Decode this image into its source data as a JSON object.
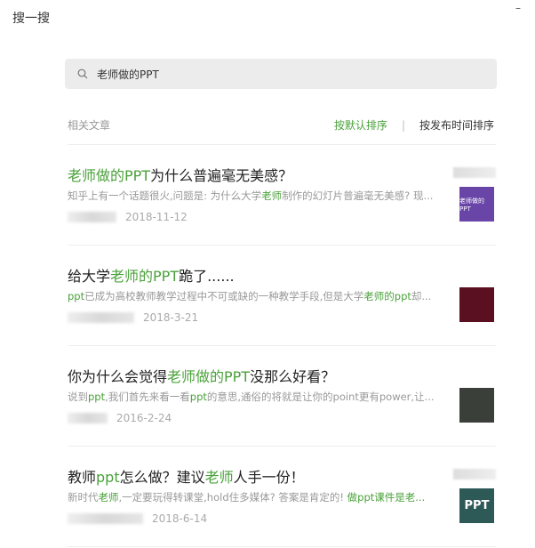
{
  "window": {
    "title": "搜一搜",
    "minimize": "–"
  },
  "search": {
    "value": "老师做的PPT"
  },
  "section_label": "相关文章",
  "sort": {
    "default": "按默认排序",
    "separator": "|",
    "by_time": "按发布时间排序"
  },
  "accent_color": "#4aa13a",
  "articles": [
    {
      "title": [
        {
          "t": "老师做的PPT",
          "hl": true
        },
        {
          "t": "为什么普遍毫无美感？",
          "hl": false
        }
      ],
      "snippet": [
        {
          "t": "知乎上有一个话题很火,问题是: 为什么大学",
          "hl": false
        },
        {
          "t": "老师",
          "hl": true
        },
        {
          "t": "制作的幻灯片普遍毫无美感? 现...",
          "hl": false
        }
      ],
      "date": "2018-11-12",
      "thumb": {
        "bg": "#6a45a8",
        "text": "老师做的PPT"
      }
    },
    {
      "title": [
        {
          "t": "给大学",
          "hl": false
        },
        {
          "t": "老师的PPT",
          "hl": true
        },
        {
          "t": "跪了......",
          "hl": false
        }
      ],
      "snippet": [
        {
          "t": "ppt",
          "hl": true
        },
        {
          "t": "已成为高校教师教学过程中不可或缺的一种教学手段,但是大学",
          "hl": false
        },
        {
          "t": "老师的ppt",
          "hl": true
        },
        {
          "t": "却...",
          "hl": false
        }
      ],
      "date": "2018-3-21",
      "thumb": {
        "bg": "#5a1020",
        "text": ""
      }
    },
    {
      "title": [
        {
          "t": "你为什么会觉得",
          "hl": false
        },
        {
          "t": "老师做的PPT",
          "hl": true
        },
        {
          "t": "没那么好看？",
          "hl": false
        }
      ],
      "snippet": [
        {
          "t": "说到",
          "hl": false
        },
        {
          "t": "ppt",
          "hl": true
        },
        {
          "t": ",我们首先来看一看",
          "hl": false
        },
        {
          "t": "ppt",
          "hl": true
        },
        {
          "t": "的意思,通俗的将就是让你的point更有power,让...",
          "hl": false
        }
      ],
      "date": "2016-2-24",
      "thumb": {
        "bg": "#3a3f3a",
        "text": ""
      }
    },
    {
      "title": [
        {
          "t": "教师",
          "hl": false
        },
        {
          "t": "ppt",
          "hl": true
        },
        {
          "t": "怎么做？建议",
          "hl": false
        },
        {
          "t": "老师",
          "hl": true
        },
        {
          "t": "人手一份！",
          "hl": false
        }
      ],
      "snippet": [
        {
          "t": "新时代",
          "hl": false
        },
        {
          "t": "老师",
          "hl": true
        },
        {
          "t": ",一定要玩得转课堂,hold住多媒体? 答案是肯定的! ",
          "hl": false
        },
        {
          "t": "做ppt课件是老...",
          "hl": true
        }
      ],
      "date": "2018-6-14",
      "thumb": {
        "bg": "#2d5a57",
        "text": "PPT"
      }
    }
  ]
}
